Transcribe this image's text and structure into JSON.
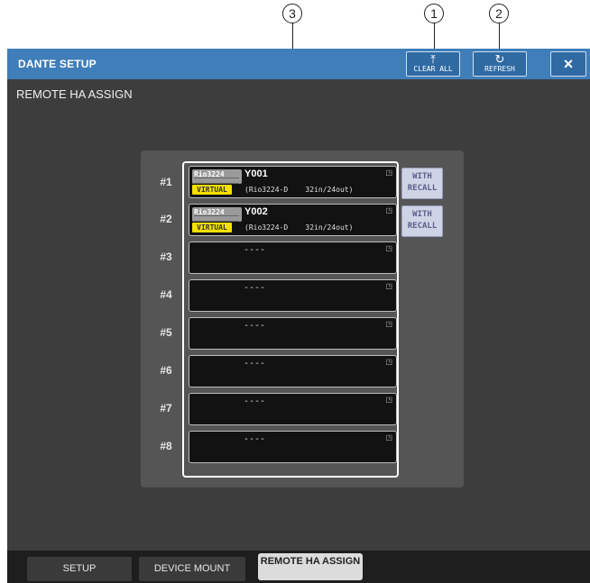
{
  "callouts": [
    "1",
    "2",
    "3"
  ],
  "window": {
    "title": "DANTE SETUP",
    "section_title": "REMOTE HA ASSIGN",
    "clear_all_label": "CLEAR ALL",
    "refresh_label": "REFRESH",
    "close_icon": "×"
  },
  "slots": [
    {
      "num": "#1",
      "name": "Y001",
      "model": "Rio3224",
      "badge": "VIRTUAL",
      "info": "(Rio3224-D    32in/24out)",
      "recall": "WITH\nRECALL"
    },
    {
      "num": "#2",
      "name": "Y002",
      "model": "Rio3224",
      "badge": "VIRTUAL",
      "info": "(Rio3224-D    32in/24out)",
      "recall": "WITH\nRECALL"
    },
    {
      "num": "#3",
      "empty": "----"
    },
    {
      "num": "#4",
      "empty": "----"
    },
    {
      "num": "#5",
      "empty": "----"
    },
    {
      "num": "#6",
      "empty": "----"
    },
    {
      "num": "#7",
      "empty": "----"
    },
    {
      "num": "#8",
      "empty": "----"
    }
  ],
  "tabs": [
    "SETUP",
    "DEVICE MOUNT",
    "REMOTE HA ASSIGN"
  ]
}
